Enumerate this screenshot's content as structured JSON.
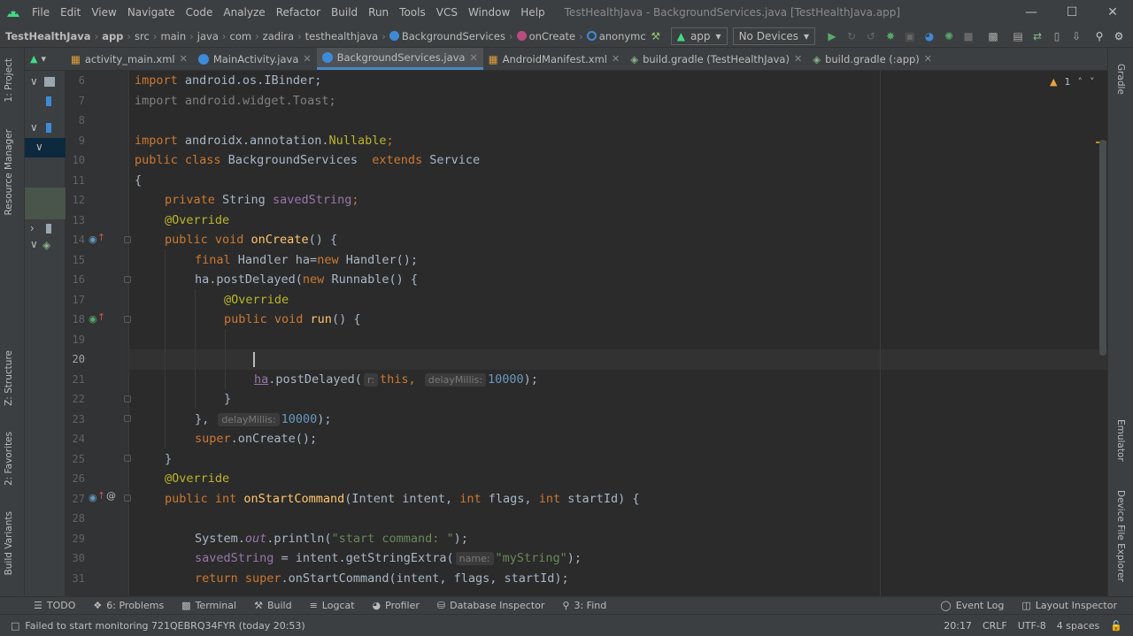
{
  "window": {
    "title": "TestHealthJava - BackgroundServices.java [TestHealthJava.app]"
  },
  "menu": [
    "File",
    "Edit",
    "View",
    "Navigate",
    "Code",
    "Analyze",
    "Refactor",
    "Build",
    "Run",
    "Tools",
    "VCS",
    "Window",
    "Help"
  ],
  "breadcrumb": [
    "TestHealthJava",
    "app",
    "src",
    "main",
    "java",
    "com",
    "zadira",
    "testhealthjava",
    "BackgroundServices",
    "onCreate",
    "anonymc"
  ],
  "toolbar": {
    "run_config": "app",
    "device": "No Devices"
  },
  "tabs": [
    {
      "label": "activity_main.xml",
      "icon": "xml-file-icon",
      "color": "#e8a33c"
    },
    {
      "label": "MainActivity.java",
      "icon": "java-class-icon",
      "color": "#3d8bd8"
    },
    {
      "label": "BackgroundServices.java",
      "icon": "java-class-icon",
      "color": "#3d8bd8"
    },
    {
      "label": "AndroidManifest.xml",
      "icon": "manifest-file-icon",
      "color": "#e8a33c"
    },
    {
      "label": "build.gradle (TestHealthJava)",
      "icon": "gradle-icon",
      "color": "#8ab48a"
    },
    {
      "label": "build.gradle (:app)",
      "icon": "gradle-icon",
      "color": "#8ab48a"
    }
  ],
  "left_tools": {
    "project": "1: Project",
    "resource": "Resource Manager",
    "structure": "Z: Structure",
    "favorites": "2: Favorites",
    "variants": "Build Variants"
  },
  "right_tools": {
    "gradle": "Gradle",
    "emulator": "Emulator",
    "device_explorer": "Device File Explorer"
  },
  "editor": {
    "warnings": "1",
    "lines": [
      {
        "n": "6"
      },
      {
        "n": "7"
      },
      {
        "n": "8"
      },
      {
        "n": "9"
      },
      {
        "n": "10"
      },
      {
        "n": "11"
      },
      {
        "n": "12"
      },
      {
        "n": "13"
      },
      {
        "n": "14"
      },
      {
        "n": "15"
      },
      {
        "n": "16"
      },
      {
        "n": "17"
      },
      {
        "n": "18"
      },
      {
        "n": "19"
      },
      {
        "n": "20"
      },
      {
        "n": "21"
      },
      {
        "n": "22"
      },
      {
        "n": "23"
      },
      {
        "n": "24"
      },
      {
        "n": "25"
      },
      {
        "n": "26"
      },
      {
        "n": "27"
      },
      {
        "n": "28"
      },
      {
        "n": "29"
      },
      {
        "n": "30"
      },
      {
        "n": "31"
      }
    ],
    "code": {
      "l6_a": "import",
      "l6_b": " android.os.IBinder;",
      "l7": "import android.widget.Toast;",
      "l9_a": "import",
      "l9_b": " androidx.annotation.",
      "l9_c": "Nullable",
      "l9_d": ";",
      "l10_a": "public class",
      "l10_b": " BackgroundServices  ",
      "l10_c": "extends",
      "l10_d": " Service",
      "l11": "{",
      "l12_a": "private",
      "l12_b": " String ",
      "l12_c": "savedString",
      "l12_d": ";",
      "l13": "@Override",
      "l14_a": "public void",
      "l14_b": " ",
      "l14_c": "onCreate",
      "l14_d": "() {",
      "l15_a": "final",
      "l15_b": " Handler ha=",
      "l15_c": "new",
      "l15_d": " Handler();",
      "l16_a": "ha.postDelayed(",
      "l16_b": "new",
      "l16_c": " Runnable() {",
      "l17": "@Override",
      "l18_a": "public void",
      "l18_b": " ",
      "l18_c": "run",
      "l18_d": "() {",
      "l21_a": "ha",
      "l21_b": ".postDelayed(",
      "l21_hint1": "r:",
      "l21_c": "this",
      "l21_d": ",",
      "l21_hint2": "delayMillis:",
      "l21_e": "10000",
      "l21_f": ");",
      "l22": "}",
      "l23_a": "},",
      "l23_hint": "delayMillis:",
      "l23_b": "10000",
      "l23_c": ");",
      "l24_a": "super",
      "l24_b": ".onCreate();",
      "l25": "}",
      "l26": "@Override",
      "l27_a": "public int",
      "l27_b": " ",
      "l27_c": "onStartCommand",
      "l27_d": "(Intent intent, ",
      "l27_e": "int",
      "l27_f": " flags, ",
      "l27_g": "int",
      "l27_h": " startId) {",
      "l29_a": "System.",
      "l29_b": "out",
      "l29_c": ".println(",
      "l29_d": "\"start command: \"",
      "l29_e": ");",
      "l30_a": "savedString",
      "l30_b": " = intent.getStringExtra(",
      "l30_hint": "name:",
      "l30_c": "\"myString\"",
      "l30_d": ");",
      "l31_a": "return super",
      "l31_b": ".onStartCommand(intent, flags, startId);"
    }
  },
  "bottom_tools": [
    {
      "label": "TODO",
      "icon": "list-icon"
    },
    {
      "label": "6: Problems",
      "icon": "problems-icon"
    },
    {
      "label": "Terminal",
      "icon": "terminal-icon"
    },
    {
      "label": "Build",
      "icon": "hammer-icon"
    },
    {
      "label": "Logcat",
      "icon": "logcat-icon"
    },
    {
      "label": "Profiler",
      "icon": "profiler-icon"
    },
    {
      "label": "Database Inspector",
      "icon": "database-icon"
    },
    {
      "label": "3: Find",
      "icon": "search-icon"
    }
  ],
  "bottom_right_tools": [
    {
      "label": "Event Log",
      "icon": "event-log-icon"
    },
    {
      "label": "Layout Inspector",
      "icon": "layout-inspector-icon"
    }
  ],
  "status": {
    "message": "Failed to start monitoring 721QEBRQ34FYR (today 20:53)",
    "position": "20:17",
    "line_sep": "CRLF",
    "encoding": "UTF-8",
    "indent": "4 spaces"
  }
}
